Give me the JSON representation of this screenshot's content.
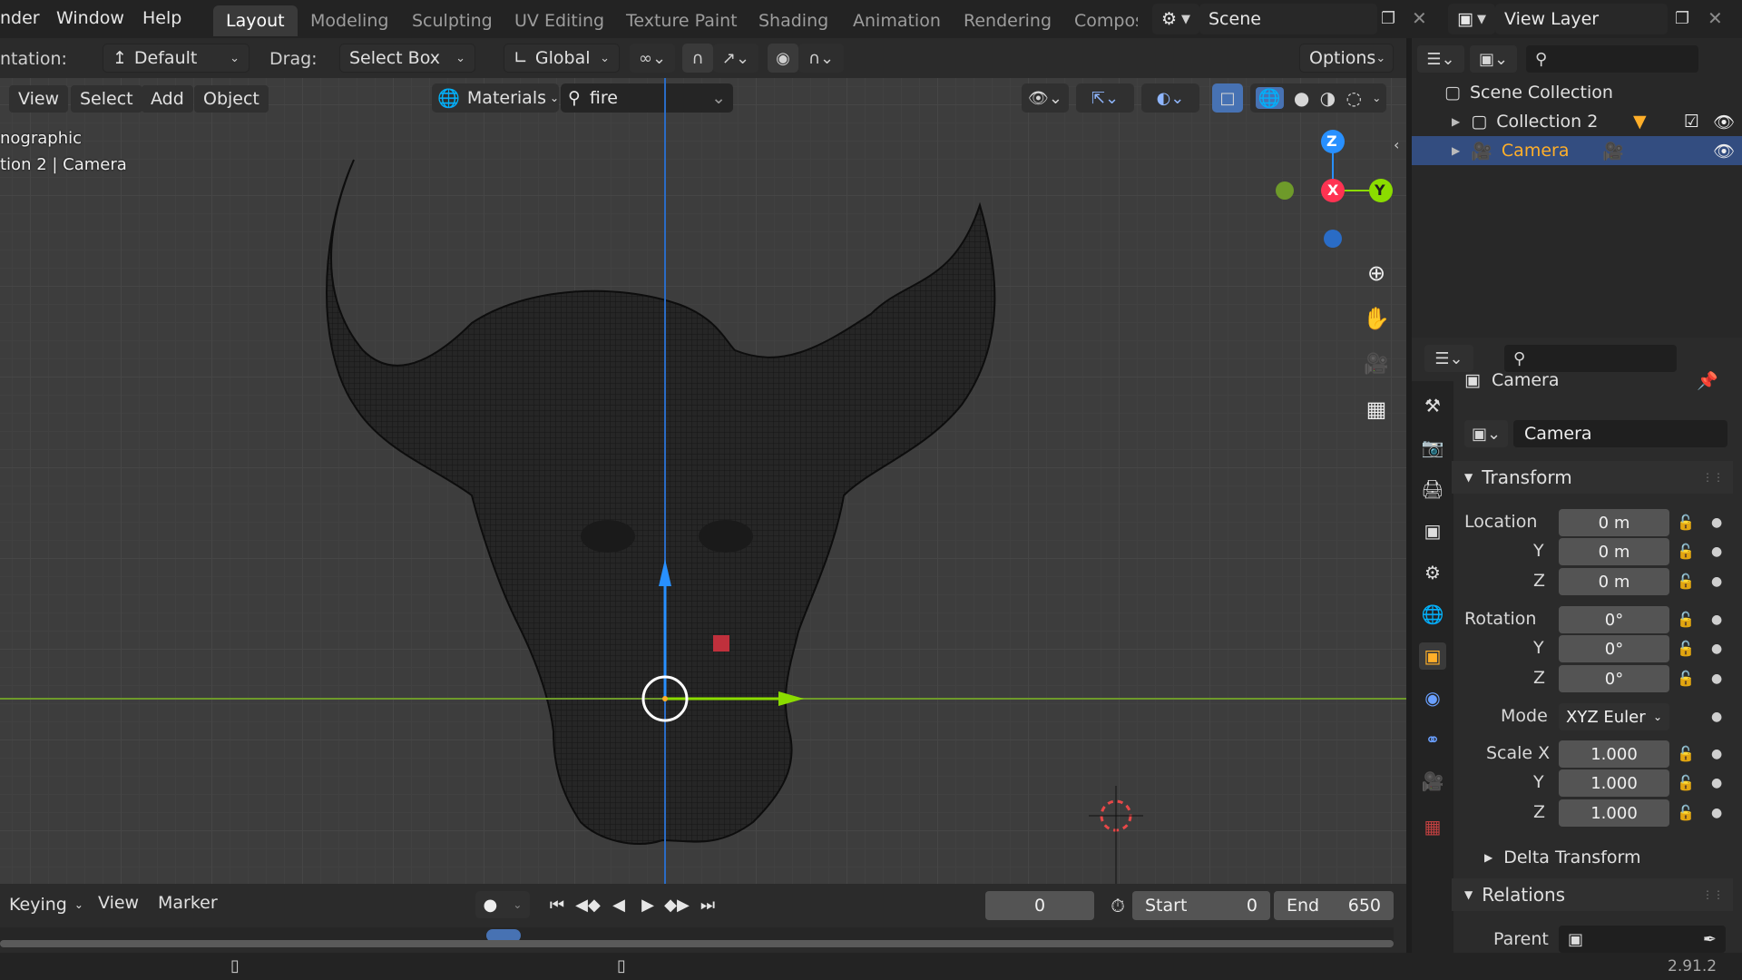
{
  "topbar": {
    "menus": [
      "nder",
      "Window",
      "Help"
    ],
    "workspaces": [
      "Layout",
      "Modeling",
      "Sculpting",
      "UV Editing",
      "Texture Paint",
      "Shading",
      "Animation",
      "Rendering",
      "Compos"
    ],
    "active_workspace": "Layout",
    "scene": "Scene",
    "view_layer": "View Layer"
  },
  "toolbar": {
    "orientation_label": "ntation:",
    "orientation_value": "Default",
    "drag_label": "Drag:",
    "drag_value": "Select Box",
    "transform_orientation": "Global",
    "options_label": "Options"
  },
  "viewport": {
    "menus": [
      "View",
      "Select",
      "Add",
      "Object"
    ],
    "material_filter_label": "Materials",
    "search_value": "fire",
    "overlay_line1": "nographic",
    "overlay_line2": "tion 2 | Camera",
    "gizmo": {
      "x": "X",
      "y": "Y",
      "z": "Z"
    }
  },
  "outliner": {
    "scene_collection": "Scene Collection",
    "items": [
      {
        "label": "Collection 2",
        "selected": false
      },
      {
        "label": "Camera",
        "selected": true
      }
    ]
  },
  "properties": {
    "object_name": "Camera",
    "data_name": "Camera",
    "transform_header": "Transform",
    "location_label": "Location",
    "location": [
      "0 m",
      "0 m",
      "0 m"
    ],
    "rotation_label": "Rotation",
    "rotation": [
      "0°",
      "0°",
      "0°"
    ],
    "mode_label": "Mode",
    "mode_value": "XYZ Euler",
    "scale_label": "Scale X",
    "scale": [
      "1.000",
      "1.000",
      "1.000"
    ],
    "axis_y": "Y",
    "axis_z": "Z",
    "delta_transform": "Delta Transform",
    "relations_header": "Relations",
    "parent_label": "Parent"
  },
  "timeline": {
    "keying": "Keying",
    "view": "View",
    "marker": "Marker",
    "current_frame": "0",
    "start_label": "Start",
    "start_value": "0",
    "end_label": "End",
    "end_value": "650"
  },
  "statusbar": {
    "version": "2.91.2"
  },
  "colors": {
    "accent_blue": "#4772b3",
    "selected_row": "#334d80",
    "camera_orange": "#ffaf29",
    "axis_x": "#ff3352",
    "axis_y": "#8bdc00",
    "axis_z": "#2890ff"
  }
}
